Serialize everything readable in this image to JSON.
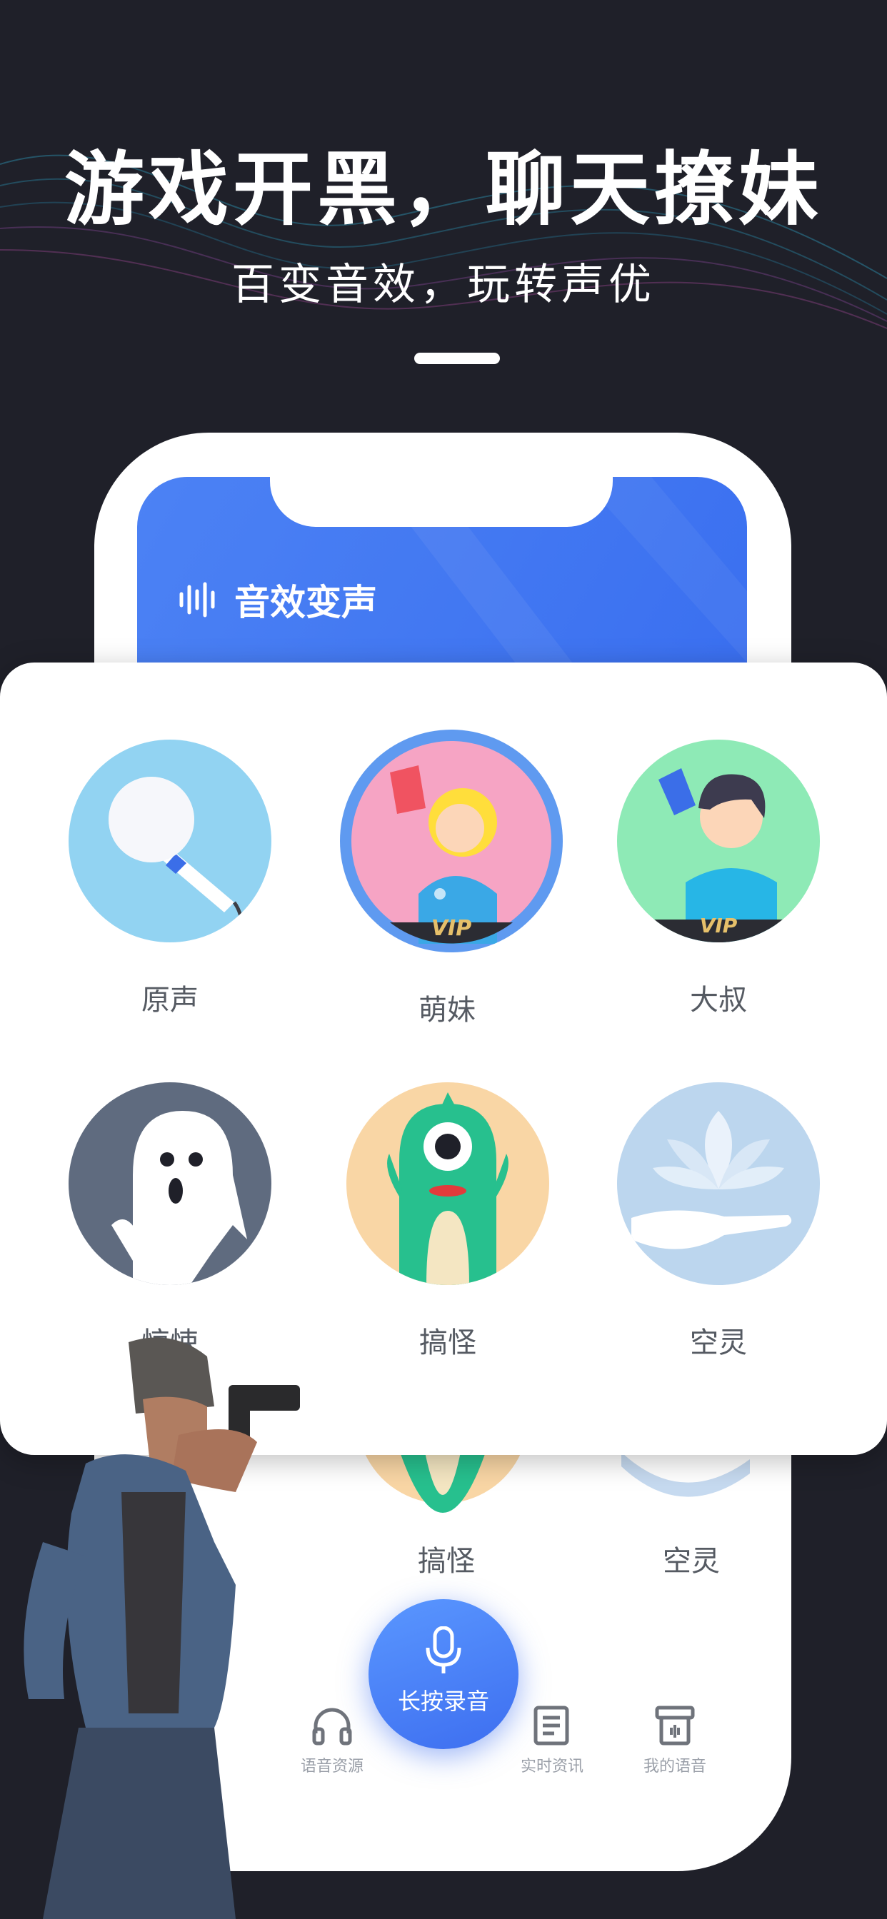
{
  "hero": {
    "headline": "游戏开黑，聊天撩妹",
    "subline": "百变音效，玩转声优"
  },
  "app": {
    "title": "音效变声",
    "title_icon": "sound-wave-icon",
    "accent": "#3a6ff0"
  },
  "effects": [
    {
      "label": "原声",
      "icon": "microphone-icon",
      "vip": false
    },
    {
      "label": "萌妹",
      "icon": "girl-selfie-icon",
      "vip": true,
      "badge": "VIP"
    },
    {
      "label": "大叔",
      "icon": "boy-selfie-icon",
      "vip": true,
      "badge": "VIP"
    },
    {
      "label": "惊悚",
      "icon": "ghost-icon",
      "vip": false
    },
    {
      "label": "搞怪",
      "icon": "monster-icon",
      "vip": false
    },
    {
      "label": "空灵",
      "icon": "lotus-icon",
      "vip": false
    }
  ],
  "under_card": {
    "label_1": "搞怪",
    "label_2": "空灵"
  },
  "record_button": {
    "label": "长按录音",
    "icon": "mic-icon"
  },
  "tabs": [
    {
      "label": "语音资源",
      "icon": "headphones-icon"
    },
    {
      "label": "实时资讯",
      "icon": "news-icon"
    },
    {
      "label": "我的语音",
      "icon": "voice-box-icon"
    }
  ]
}
